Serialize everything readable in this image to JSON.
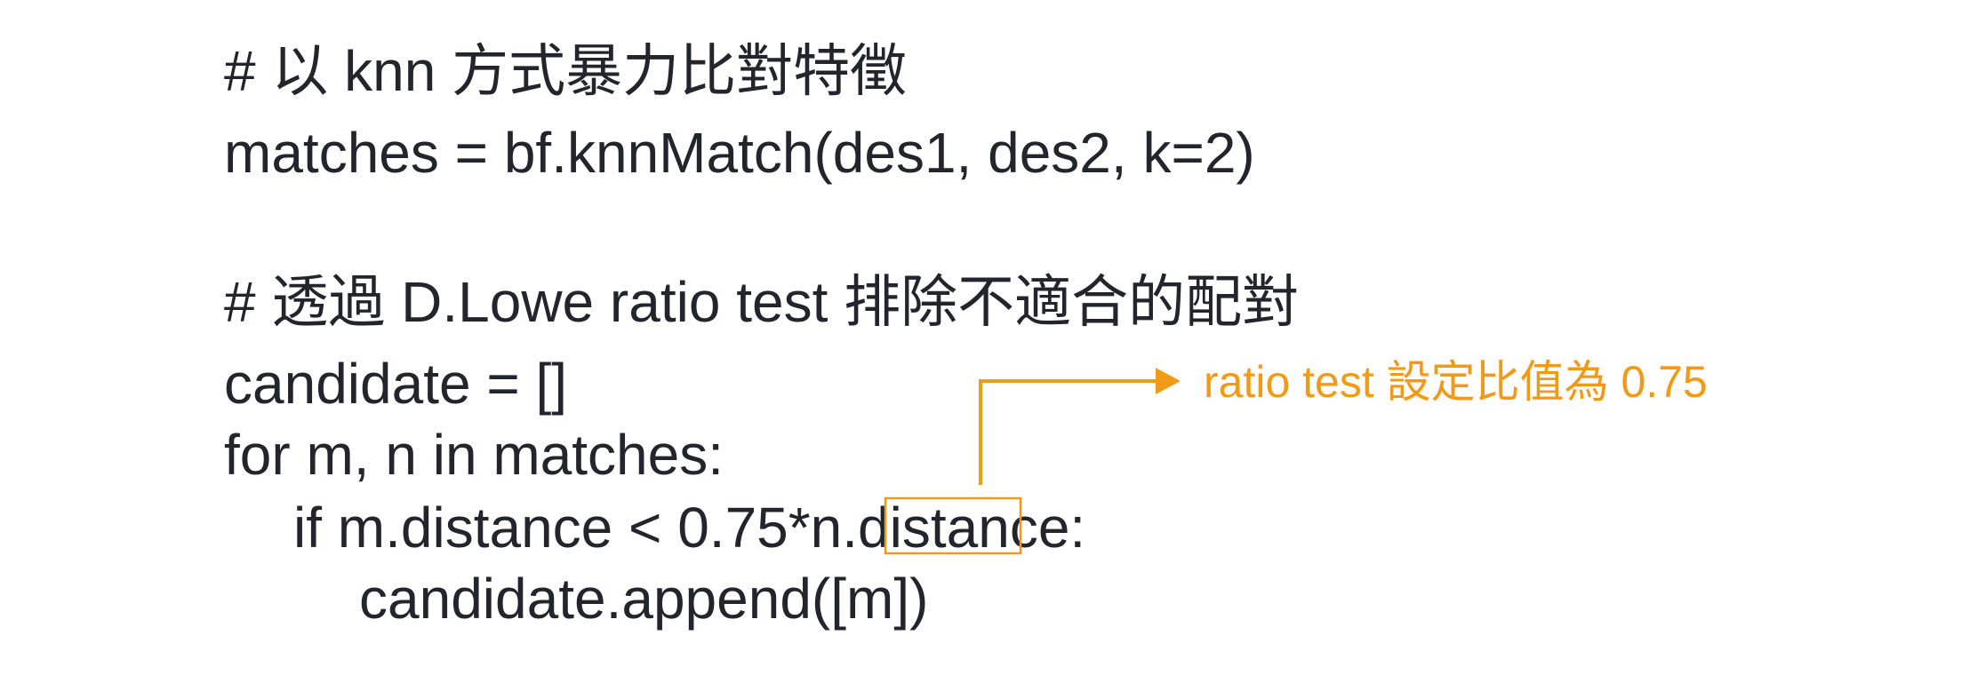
{
  "code_lines": [
    "# 以 knn 方式暴力比對特徵",
    "matches = bf.knnMatch(des1, des2, k=2)",
    "# 透過 D.Lowe ratio test 排除不適合的配對",
    "candidate = []",
    "for m, n in matches:",
    "if m.distance < 0.75*n.distance:",
    "candidate.append([m])"
  ],
  "annotation": {
    "text": "ratio test 設定比值為 0.75",
    "color": "#f29a17"
  },
  "colors": {
    "code_text": "#22252c",
    "highlight": "#f29a17",
    "background": "#ffffff"
  }
}
